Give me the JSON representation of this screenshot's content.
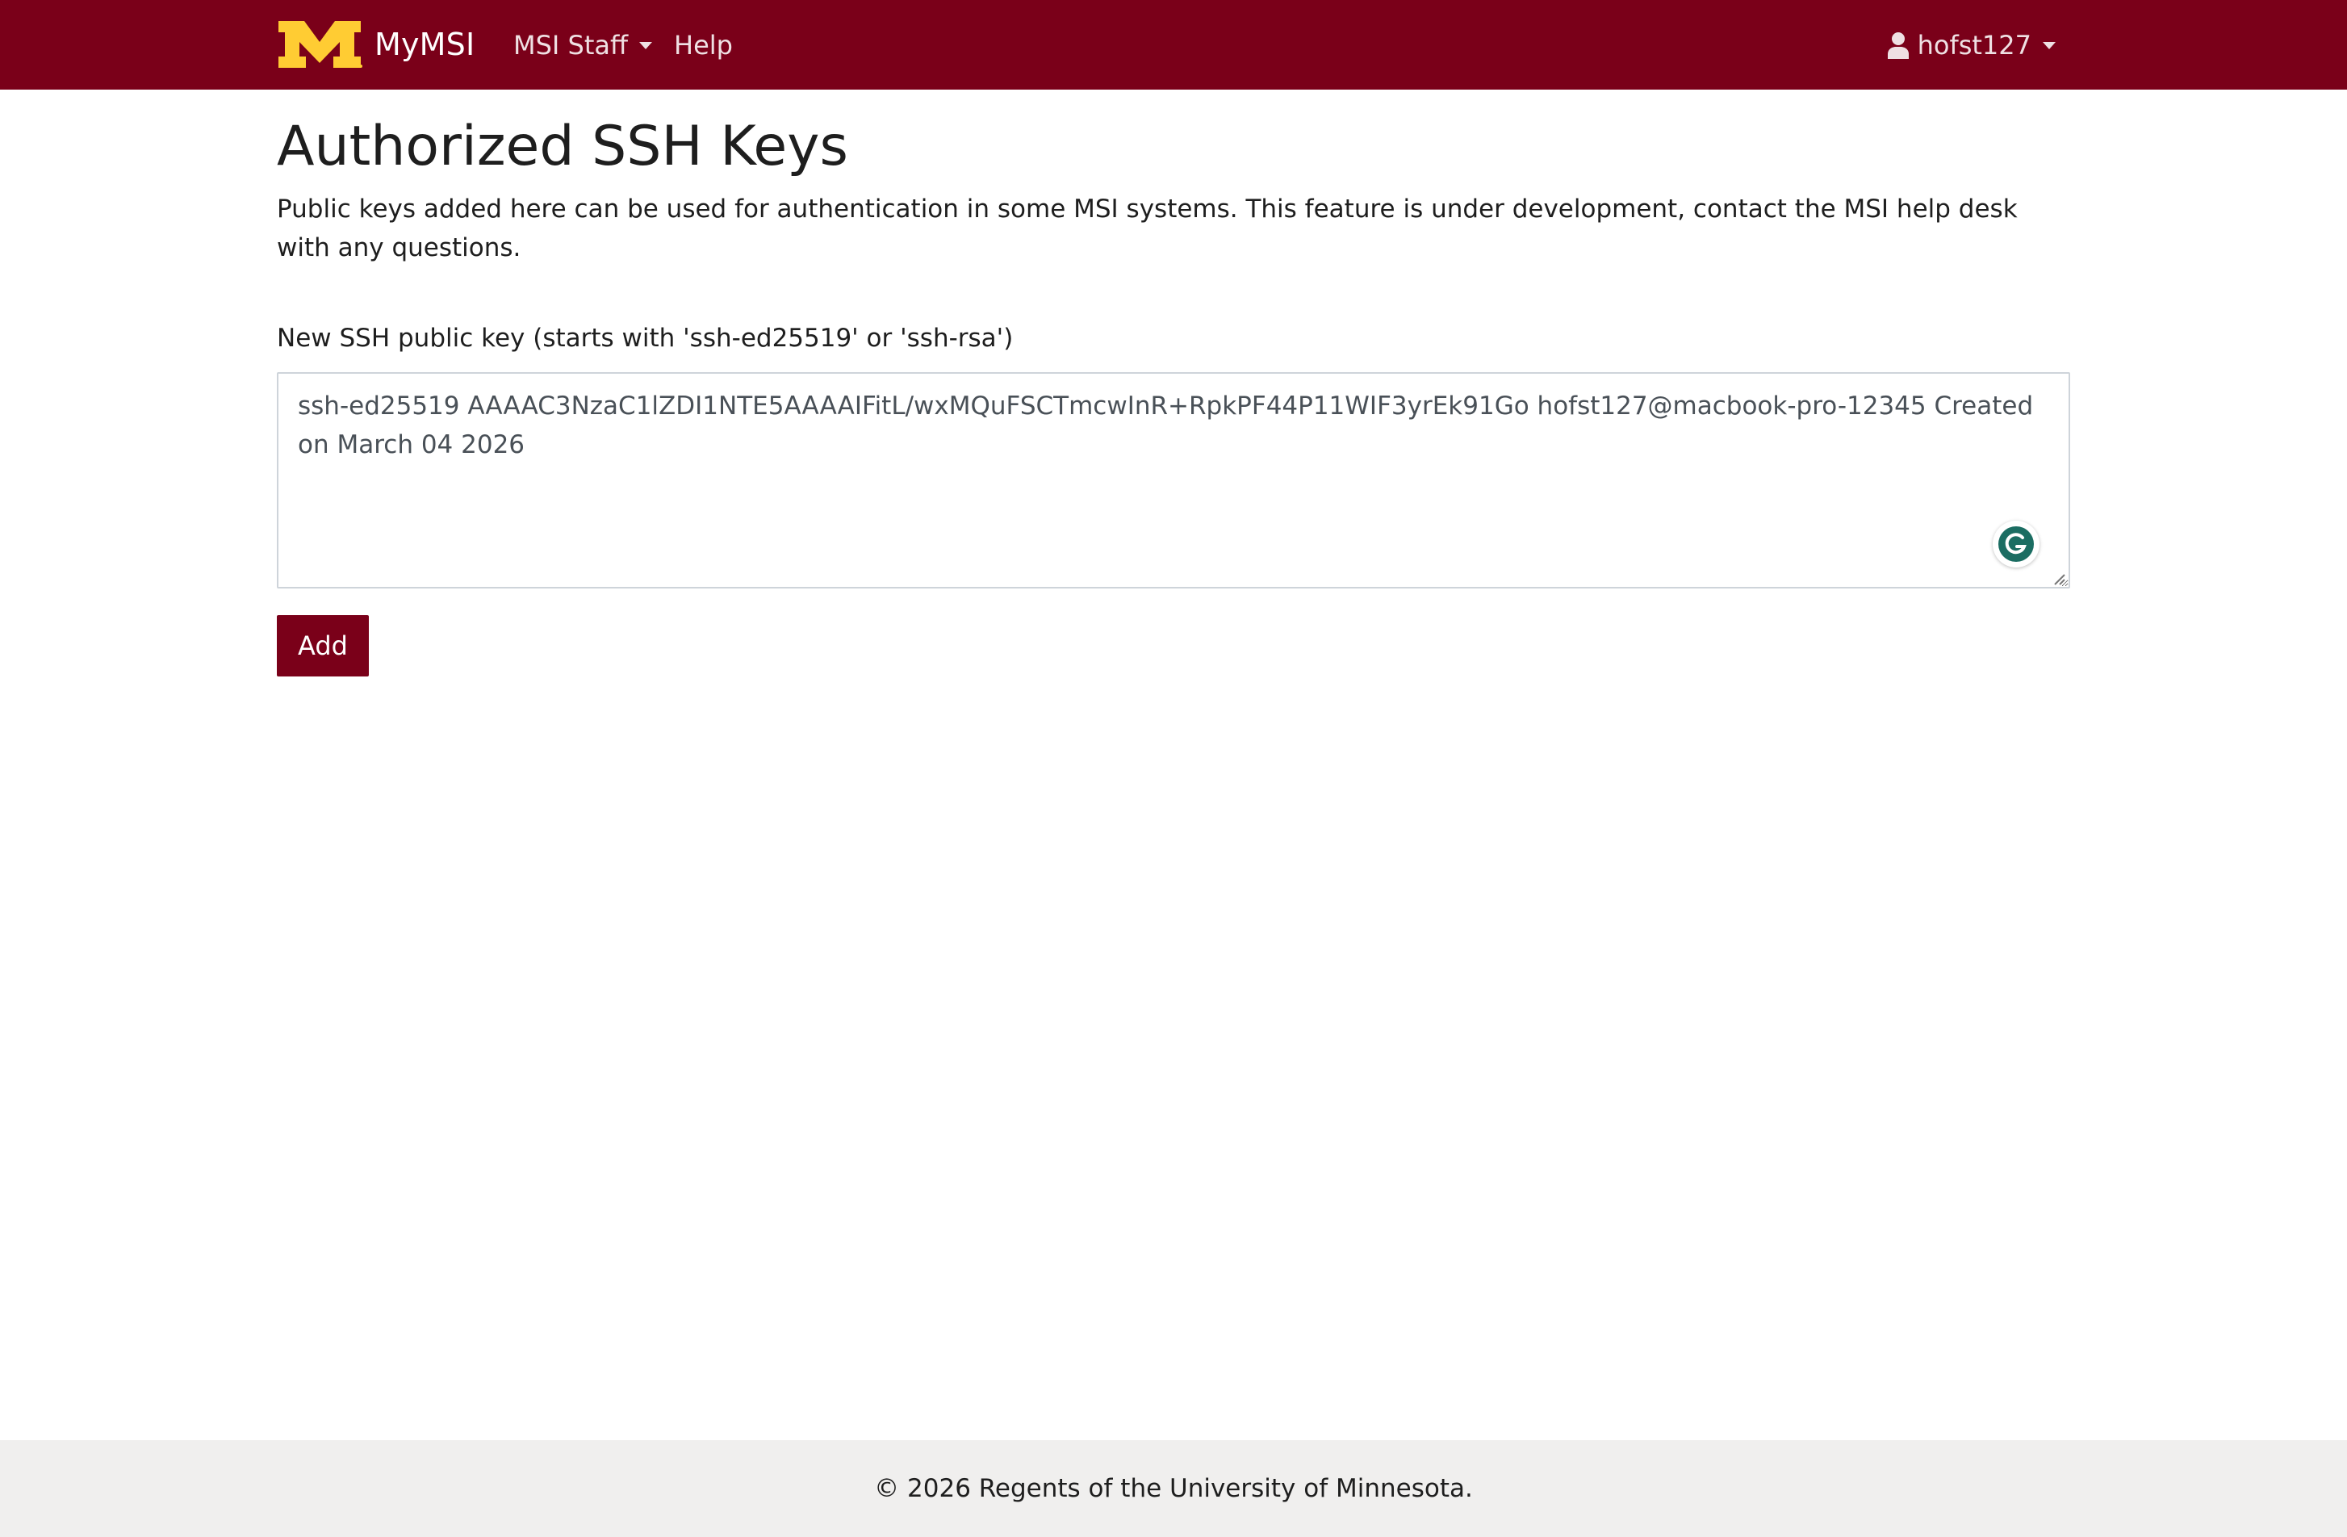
{
  "navbar": {
    "brand": "MyMSI",
    "logo_icon": "umn-block-m-logo",
    "items": [
      {
        "label": "MSI Staff",
        "has_dropdown": true
      },
      {
        "label": "Help",
        "has_dropdown": false
      }
    ],
    "user": {
      "icon": "user-icon",
      "username": "hofst127",
      "has_dropdown": true
    }
  },
  "main": {
    "title": "Authorized SSH Keys",
    "description": "Public keys added here can be used for authentication in some MSI systems. This feature is under development, contact the MSI help desk with any questions.",
    "form": {
      "label": "New SSH public key (starts with 'ssh-ed25519' or 'ssh-rsa')",
      "key_value": "ssh-ed25519 AAAAC3NzaC1lZDI1NTE5AAAAIFitL/wxMQuFSCTmcwInR+RpkPF44P11WIF3yrEk91Go hofst127@macbook-pro-12345 Created on March 04 2026",
      "grammarly_icon": "grammarly-icon",
      "submit_label": "Add"
    }
  },
  "footer": {
    "text": "© 2026 Regents of the University of Minnesota."
  },
  "colors": {
    "brand_maroon": "#7a0019",
    "brand_gold": "#ffcc33",
    "footer_bg": "#f0efee",
    "grammarly_green": "#15c39a"
  }
}
